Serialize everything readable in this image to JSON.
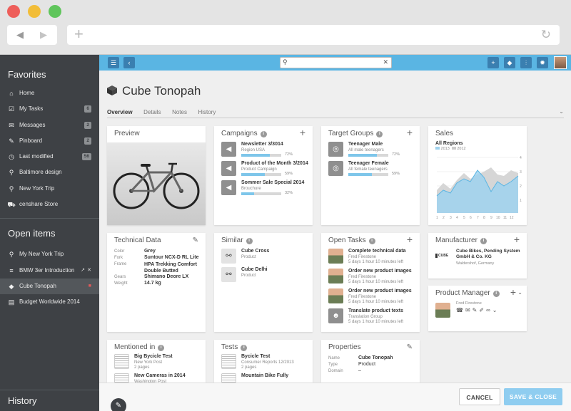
{
  "sidebar": {
    "favorites_label": "Favorites",
    "favorites": [
      {
        "label": "Home",
        "icon": "home-icon",
        "glyph": "⌂"
      },
      {
        "label": "My Tasks",
        "icon": "checklist-icon",
        "glyph": "☑",
        "count": "6"
      },
      {
        "label": "Messages",
        "icon": "envelope-icon",
        "glyph": "✉",
        "count": "2"
      },
      {
        "label": "Pinboard",
        "icon": "pin-icon",
        "glyph": "✎",
        "count": "2"
      },
      {
        "label": "Last modified",
        "icon": "clock-icon",
        "glyph": "◷",
        "count": "56"
      },
      {
        "label": "Baltimore design",
        "icon": "search-icon",
        "glyph": "⚲"
      },
      {
        "label": "New York Trip",
        "icon": "search-icon",
        "glyph": "⚲"
      },
      {
        "label": "censhare Store",
        "icon": "cart-icon",
        "glyph": "⛟"
      }
    ],
    "open_items_label": "Open items",
    "open_items": [
      {
        "label": "My New York Trip",
        "icon": "search-icon",
        "glyph": "⚲"
      },
      {
        "label": "BMW 3er Introduction",
        "icon": "list-icon",
        "glyph": "≡"
      },
      {
        "label": "Cube Tonopah",
        "icon": "cube-icon",
        "glyph": "◆"
      },
      {
        "label": "Budget Worldwide 2014",
        "icon": "budget-icon",
        "glyph": "▤"
      }
    ],
    "history_label": "History"
  },
  "page": {
    "title": "Cube Tonopah",
    "tabs": [
      "Overview",
      "Details",
      "Notes",
      "History"
    ]
  },
  "cards": {
    "preview": {
      "title": "Preview"
    },
    "campaigns": {
      "title": "Campaigns",
      "items": [
        {
          "title": "Newsletter 3/3014",
          "sub": "Region USA",
          "pct": "72%",
          "fill": 72
        },
        {
          "title": "Product of the Month 3/2014",
          "sub": "Product Campaign",
          "pct": "59%",
          "fill": 59
        },
        {
          "title": "Sommer Sale Special 2014",
          "sub": "Brouchure",
          "pct": "32%",
          "fill": 32
        }
      ]
    },
    "target_groups": {
      "title": "Target Groups",
      "items": [
        {
          "title": "Teenager Male",
          "sub": "All male teenagers",
          "pct": "72%",
          "fill": 72
        },
        {
          "title": "Teenager Female",
          "sub": "All female teenagers",
          "pct": "59%",
          "fill": 59
        }
      ]
    },
    "sales": {
      "title": "Sales",
      "subtitle": "All Regions",
      "legend": [
        "2013",
        "2012"
      ],
      "ticks_x": [
        "1",
        "2",
        "3",
        "4",
        "5",
        "6",
        "7",
        "8",
        "9",
        "10",
        "11",
        "12"
      ],
      "ticks_y": [
        "4",
        "3",
        "2",
        "1"
      ]
    },
    "technical": {
      "title": "Technical Data",
      "rows": [
        {
          "k": "Color",
          "v": "Grey"
        },
        {
          "k": "Fork",
          "v": "Suntour NCX-D RL Lite"
        },
        {
          "k": "Frame",
          "v": "HPA Trekking Comfort Double Butted"
        },
        {
          "k": "Gears",
          "v": "Shimano Deore LX"
        },
        {
          "k": "Weight",
          "v": "14.7 kg"
        }
      ]
    },
    "similar": {
      "title": "Similar",
      "items": [
        {
          "title": "Cube Cross",
          "sub": "Product"
        },
        {
          "title": "Cube Delhi",
          "sub": "Product"
        }
      ]
    },
    "open_tasks": {
      "title": "Open Tasks",
      "items": [
        {
          "title": "Complete technical data",
          "sub1": "Fred Firestone",
          "sub2": "5 days 1 hour 10 minutes left"
        },
        {
          "title": "Order new product images",
          "sub1": "Fred Firestone",
          "sub2": "5 days 1 hour 10 minutes left"
        },
        {
          "title": "Order new product images",
          "sub1": "Fred Firestone",
          "sub2": "5 days 1 hour 10 minutes left"
        },
        {
          "title": "Translate product texts",
          "sub1": "Translation Group",
          "sub2": "5 days 1 hour 10 minutes left"
        }
      ]
    },
    "manufacturer": {
      "title": "Manufacturer",
      "name": "Cube Bikes, Pending System GmbH & Co. KG",
      "location": "Waldershof, Germany",
      "logo": "CUBE"
    },
    "product_manager": {
      "title": "Product Manager",
      "name": "Fred Firestone"
    },
    "mentioned": {
      "title": "Mentioned in",
      "items": [
        {
          "title": "Big Bycicle Test",
          "sub1": "New York Post",
          "sub2": "2 pages"
        },
        {
          "title": "New Cameras in 2014",
          "sub1": "Washington Post",
          "sub2": ""
        }
      ]
    },
    "tests": {
      "title": "Tests",
      "items": [
        {
          "title": "Bycicle Test",
          "sub1": "Consumer Reports 12/2013",
          "sub2": "2 pages"
        },
        {
          "title": "Mountain Bike Fully",
          "sub1": "",
          "sub2": ""
        }
      ]
    },
    "properties": {
      "title": "Properties",
      "rows": [
        {
          "k": "Name",
          "v": "Cube Tonopah"
        },
        {
          "k": "Type",
          "v": "Product"
        },
        {
          "k": "Domain",
          "v": "–"
        }
      ]
    }
  },
  "footer": {
    "cancel": "CANCEL",
    "save": "SAVE & CLOSE"
  },
  "colors": {
    "accent": "#5ab5e3",
    "sidebar": "#3e4145",
    "save": "#8fcdf0"
  }
}
